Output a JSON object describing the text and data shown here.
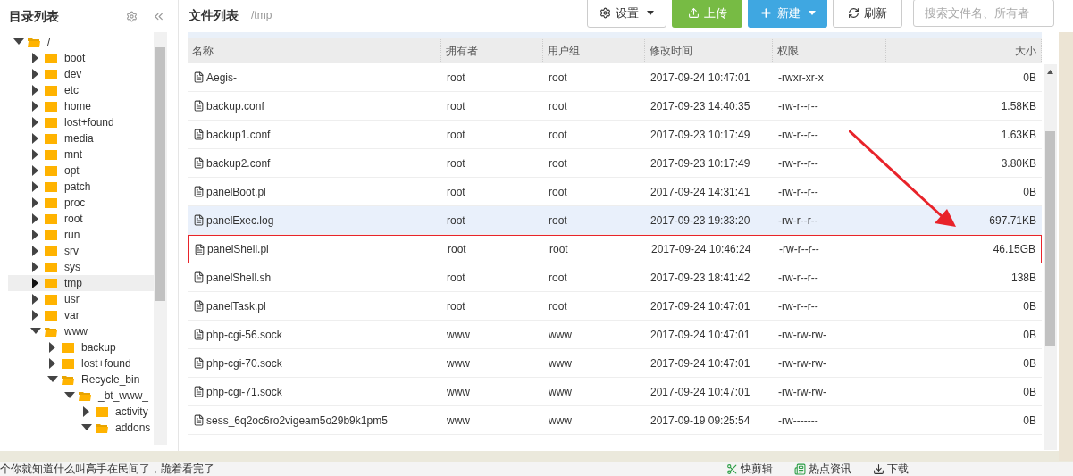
{
  "sidebar": {
    "title": "目录列表",
    "tree": [
      {
        "label": "/",
        "expanded": true,
        "selected": false,
        "children": [
          {
            "label": "boot",
            "expanded": false,
            "selected": false
          },
          {
            "label": "dev",
            "expanded": false,
            "selected": false
          },
          {
            "label": "etc",
            "expanded": false,
            "selected": false
          },
          {
            "label": "home",
            "expanded": false,
            "selected": false
          },
          {
            "label": "lost+found",
            "expanded": false,
            "selected": false
          },
          {
            "label": "media",
            "expanded": false,
            "selected": false
          },
          {
            "label": "mnt",
            "expanded": false,
            "selected": false
          },
          {
            "label": "opt",
            "expanded": false,
            "selected": false
          },
          {
            "label": "patch",
            "expanded": false,
            "selected": false
          },
          {
            "label": "proc",
            "expanded": false,
            "selected": false
          },
          {
            "label": "root",
            "expanded": false,
            "selected": false
          },
          {
            "label": "run",
            "expanded": false,
            "selected": false
          },
          {
            "label": "srv",
            "expanded": false,
            "selected": false
          },
          {
            "label": "sys",
            "expanded": false,
            "selected": false
          },
          {
            "label": "tmp",
            "expanded": false,
            "selected": true
          },
          {
            "label": "usr",
            "expanded": false,
            "selected": false
          },
          {
            "label": "var",
            "expanded": false,
            "selected": false
          },
          {
            "label": "www",
            "expanded": true,
            "selected": false,
            "children": [
              {
                "label": "backup",
                "expanded": false,
                "selected": false
              },
              {
                "label": "lost+found",
                "expanded": false,
                "selected": false
              },
              {
                "label": "Recycle_bin",
                "expanded": true,
                "selected": false,
                "children": [
                  {
                    "label": "_bt_www_",
                    "expanded": true,
                    "selected": false,
                    "children": [
                      {
                        "label": "activity",
                        "expanded": false,
                        "selected": false
                      },
                      {
                        "label": "addons",
                        "expanded": true,
                        "selected": false
                      }
                    ]
                  }
                ]
              }
            ]
          }
        ]
      }
    ]
  },
  "header": {
    "title": "文件列表",
    "path": "/tmp"
  },
  "toolbar": {
    "buttons": [
      {
        "kind": "settings",
        "label": "设置"
      },
      {
        "kind": "upload",
        "label": "上传"
      },
      {
        "kind": "new",
        "label": "新建"
      },
      {
        "kind": "refresh",
        "label": "刷新"
      }
    ],
    "search_placeholder": "搜索文件名、所有者"
  },
  "table": {
    "columns": [
      "名称",
      "拥有者",
      "用户组",
      "修改时间",
      "权限",
      "大小"
    ],
    "rows": [
      {
        "name": "Aegis-",
        "owner": "root",
        "group": "root",
        "modified": "2017-09-24 10:47:01",
        "perm": "-rwxr-xr-x",
        "size": "0B",
        "selected": false,
        "flagged": false
      },
      {
        "name": "backup.conf",
        "owner": "root",
        "group": "root",
        "modified": "2017-09-23 14:40:35",
        "perm": "-rw-r--r--",
        "size": "1.58KB",
        "selected": false,
        "flagged": false
      },
      {
        "name": "backup1.conf",
        "owner": "root",
        "group": "root",
        "modified": "2017-09-23 10:17:49",
        "perm": "-rw-r--r--",
        "size": "1.63KB",
        "selected": false,
        "flagged": false
      },
      {
        "name": "backup2.conf",
        "owner": "root",
        "group": "root",
        "modified": "2017-09-23 10:17:49",
        "perm": "-rw-r--r--",
        "size": "3.80KB",
        "selected": false,
        "flagged": false
      },
      {
        "name": "panelBoot.pl",
        "owner": "root",
        "group": "root",
        "modified": "2017-09-24 14:31:41",
        "perm": "-rw-r--r--",
        "size": "0B",
        "selected": false,
        "flagged": false
      },
      {
        "name": "panelExec.log",
        "owner": "root",
        "group": "root",
        "modified": "2017-09-23 19:33:20",
        "perm": "-rw-r--r--",
        "size": "697.71KB",
        "selected": true,
        "flagged": false
      },
      {
        "name": "panelShell.pl",
        "owner": "root",
        "group": "root",
        "modified": "2017-09-24 10:46:24",
        "perm": "-rw-r--r--",
        "size": "46.15GB",
        "selected": false,
        "flagged": true
      },
      {
        "name": "panelShell.sh",
        "owner": "root",
        "group": "root",
        "modified": "2017-09-23 18:41:42",
        "perm": "-rw-r--r--",
        "size": "138B",
        "selected": false,
        "flagged": false
      },
      {
        "name": "panelTask.pl",
        "owner": "root",
        "group": "root",
        "modified": "2017-09-24 10:47:01",
        "perm": "-rw-r--r--",
        "size": "0B",
        "selected": false,
        "flagged": false
      },
      {
        "name": "php-cgi-56.sock",
        "owner": "www",
        "group": "www",
        "modified": "2017-09-24 10:47:01",
        "perm": "-rw-rw-rw-",
        "size": "0B",
        "selected": false,
        "flagged": false
      },
      {
        "name": "php-cgi-70.sock",
        "owner": "www",
        "group": "www",
        "modified": "2017-09-24 10:47:01",
        "perm": "-rw-rw-rw-",
        "size": "0B",
        "selected": false,
        "flagged": false
      },
      {
        "name": "php-cgi-71.sock",
        "owner": "www",
        "group": "www",
        "modified": "2017-09-24 10:47:01",
        "perm": "-rw-rw-rw-",
        "size": "0B",
        "selected": false,
        "flagged": false
      },
      {
        "name": "sess_6q2oc6ro2vigeam5o29b9k1pm5",
        "owner": "www",
        "group": "www",
        "modified": "2017-09-19 09:25:54",
        "perm": "-rw-------",
        "size": "0B",
        "selected": false,
        "flagged": false
      }
    ]
  },
  "status_bar": {
    "text": "个你就知道什么叫高手在民间了，跪着看完了",
    "items": [
      {
        "kind": "clip",
        "label": "快剪辑"
      },
      {
        "kind": "news",
        "label": "热点资讯"
      },
      {
        "kind": "download",
        "label": "下载"
      }
    ]
  }
}
